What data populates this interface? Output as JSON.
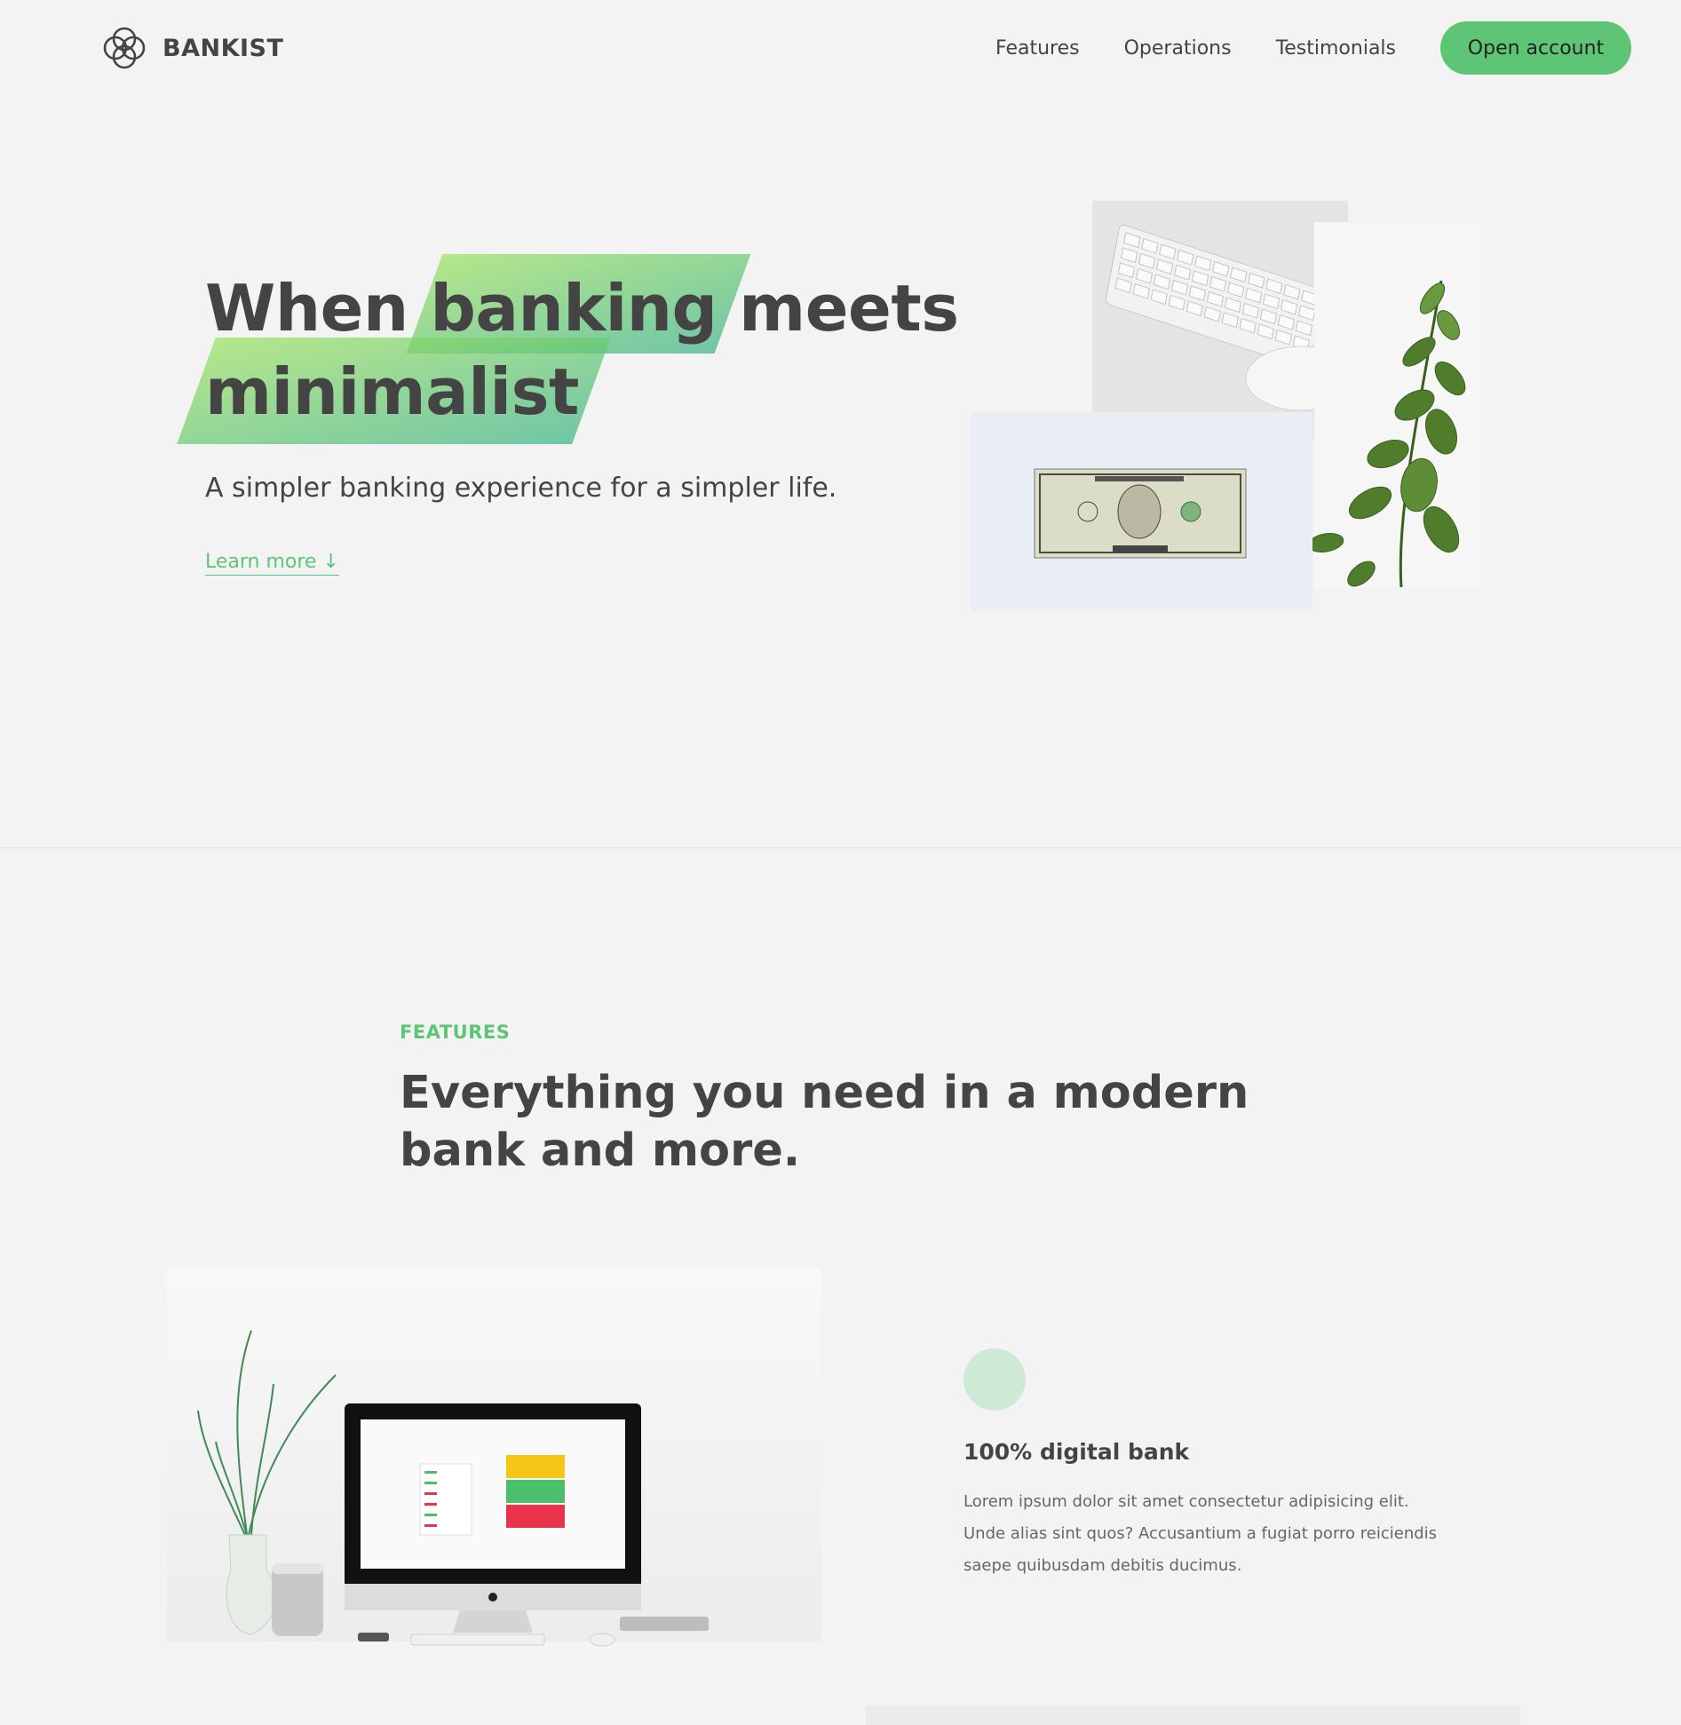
{
  "nav": {
    "brand": "BANKIST",
    "links": [
      "Features",
      "Operations",
      "Testimonials"
    ],
    "cta": "Open account"
  },
  "hero": {
    "title_line1_pre": "When",
    "title_line1_highlight": "banking",
    "title_line1_post": "meets",
    "title_line2_highlight": "minimalist",
    "subtitle": "A simpler banking experience for a simpler life.",
    "learn_more": "Learn more ↓"
  },
  "features": {
    "label": "FEATURES",
    "title": "Everything you need in a modern bank and more.",
    "item": {
      "title": "100% digital bank",
      "text": "Lorem ipsum dolor sit amet consectetur adipisicing elit. Unde alias sint quos? Accusantium a fugiat porro reiciendis saepe quibusdam debitis ducimus."
    }
  },
  "colors": {
    "accent": "#5ec576",
    "background": "#f3f3f3",
    "text": "#444444",
    "icon_circle": "#cfe9d7"
  }
}
